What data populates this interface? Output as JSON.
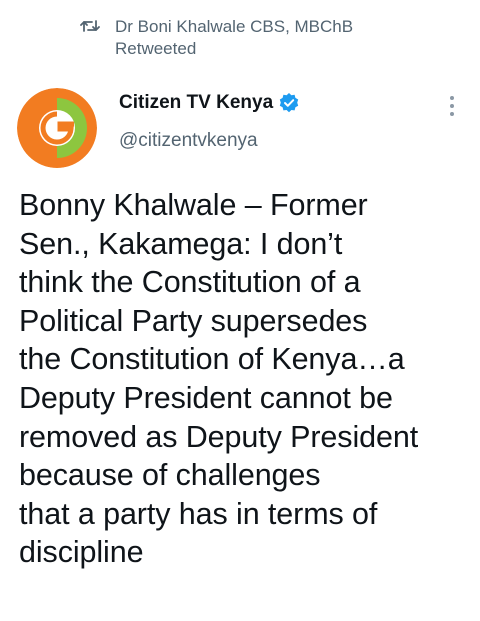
{
  "retweet": {
    "icon": "retweet-icon",
    "text": "Dr Boni Khalwale CBS, MBChB Retweeted"
  },
  "author": {
    "avatar_icon": "citizen-tv-logo",
    "display_name": "Citizen TV Kenya",
    "verified_icon": "verified-badge-icon",
    "handle": "@citizentvkenya"
  },
  "more_icon": "more-vertical-icon",
  "tweet": {
    "text": "Bonny Khalwale – Former\nSen., Kakamega: I don’t\nthink the Constitution of a\nPolitical Party supersedes\nthe Constitution of Kenya…a\nDeputy President cannot be\nremoved as Deputy President\nbecause of challenges\nthat a party has in terms of\ndiscipline"
  },
  "colors": {
    "text_primary": "#0f1419",
    "text_secondary": "#536471",
    "verified_blue": "#1d9bf0",
    "logo_orange": "#f27c21",
    "logo_green": "#8dc63f"
  }
}
